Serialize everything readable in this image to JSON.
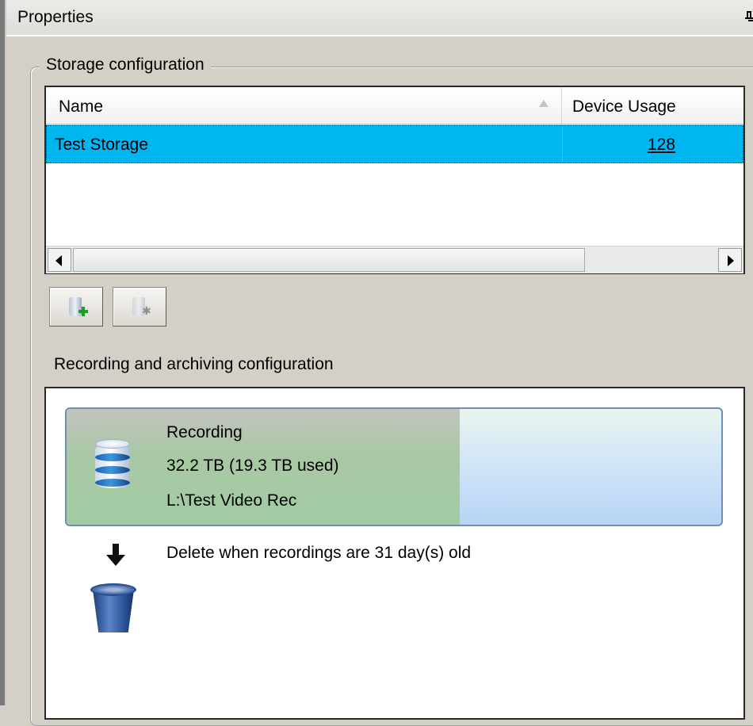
{
  "window": {
    "title": "Properties",
    "pin_icon": "pin-icon"
  },
  "storage": {
    "legend": "Storage configuration",
    "columns": [
      "Name",
      "Device Usage"
    ],
    "sort_icon": "sort-ascending-icon",
    "rows": [
      {
        "name": "Test Storage",
        "device_usage": "128",
        "selected": true,
        "selection_color": "#00b6f0"
      }
    ],
    "toolbar": {
      "add_icon": "add-storage-icon",
      "remove_icon": "remove-storage-icon"
    }
  },
  "recording": {
    "section_label": "Recording and archiving configuration",
    "title": "Recording",
    "size": "32.2 TB (19.3 TB used)",
    "path": "L:\\Test Video Rec",
    "used_fraction": 0.6,
    "icon": "database-icon",
    "delete_rule": "Delete when recordings are 31 day(s) old",
    "arrow_icon": "arrow-down-icon",
    "trash_icon": "recycle-bin-icon"
  }
}
